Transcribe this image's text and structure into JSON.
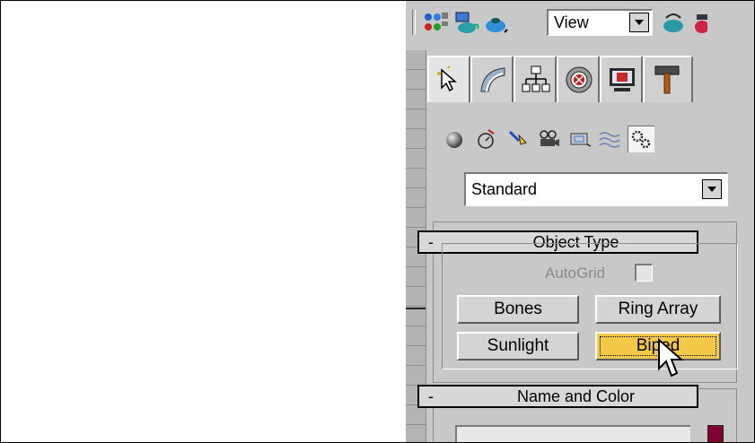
{
  "toolbar": {
    "icons": [
      "select-objects-icon",
      "render-scene-icon",
      "quick-render-icon",
      "render-type-icon"
    ],
    "render_dropdown": {
      "selected": "View"
    }
  },
  "command_panel": {
    "tabs": [
      "create-tab",
      "modify-tab",
      "hierarchy-tab",
      "motion-tab",
      "display-tab",
      "utilities-tab"
    ],
    "active_tab": "create-tab",
    "categories": [
      "geometry",
      "shapes",
      "lights",
      "cameras",
      "helpers",
      "space-warps",
      "systems"
    ],
    "active_category": "systems",
    "subcategory_dropdown": {
      "selected": "Standard"
    },
    "object_type": {
      "header_minus": "-",
      "title": "Object Type",
      "autogrid_label": "AutoGrid",
      "buttons": {
        "bones": "Bones",
        "ring_array": "Ring Array",
        "sunlight": "Sunlight",
        "biped": "Biped"
      },
      "selected_button": "Biped"
    },
    "name_and_color": {
      "header_minus": "-",
      "title": "Name and Color",
      "name_value": "",
      "color": "#800033"
    }
  }
}
